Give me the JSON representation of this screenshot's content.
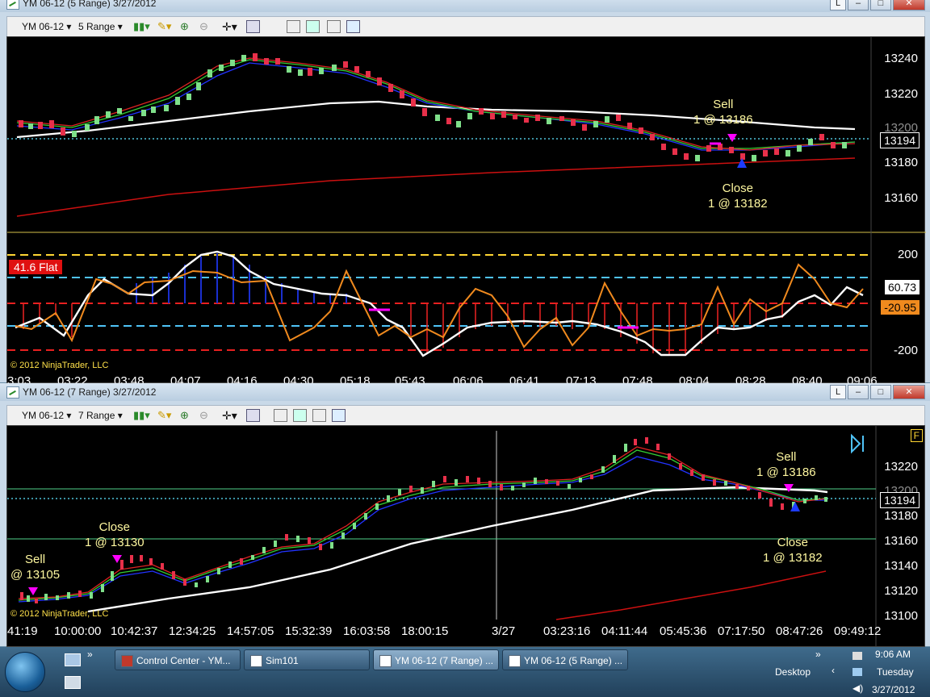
{
  "window_top": {
    "title": "YM 06-12 (5 Range)  3/27/2012",
    "toolbar": {
      "instrument": "YM 06-12",
      "period": "5 Range"
    },
    "price_panel": {
      "y_ticks": [
        "13240",
        "13220",
        "13200",
        "13180",
        "13160"
      ],
      "annotations": {
        "sell_title": "Sell",
        "sell_detail": "1 @ 13186",
        "close_title": "Close",
        "close_detail": "1 @ 13182"
      },
      "last_price": "13194",
      "ref_price": "13200"
    },
    "indicator_panel": {
      "badge": "41.6 Flat",
      "y_ticks": [
        "200",
        "-200"
      ],
      "value_white": "60.73",
      "value_orange": "-20.95",
      "copyright": "© 2012 NinjaTrader, LLC"
    },
    "x_ticks": [
      "3:03",
      "03:22",
      "03:48",
      "04:07",
      "04:16",
      "04:30",
      "05:18",
      "05:43",
      "06:06",
      "06:41",
      "07:13",
      "07:48",
      "08:04",
      "08:28",
      "08:40",
      "09:06"
    ]
  },
  "window_bottom": {
    "title": "YM 06-12 (7 Range)  3/27/2012",
    "toolbar": {
      "instrument": "YM 06-12",
      "period": "7 Range"
    },
    "lock_label": "L",
    "f_label": "F",
    "y_ticks": [
      "13220",
      "13200",
      "13180",
      "13160",
      "13140",
      "13120",
      "13100"
    ],
    "annotations": {
      "sell1_title": "Sell",
      "sell1_detail": "@ 13105",
      "close1_title": "Close",
      "close1_detail": "1 @ 13130",
      "sell2_title": "Sell",
      "sell2_detail": "1 @ 13186",
      "close2_title": "Close",
      "close2_detail": "1 @ 13182"
    },
    "last_price": "13194",
    "ref_price": "13199",
    "copyright": "© 2012 NinjaTrader, LLC",
    "x_ticks": [
      "41:19",
      "10:00:00",
      "10:42:37",
      "12:34:25",
      "14:57:05",
      "15:32:39",
      "16:03:58",
      "18:00:15",
      "3/27",
      "03:23:16",
      "04:11:44",
      "05:45:36",
      "07:17:50",
      "08:47:26",
      "09:49:12"
    ]
  },
  "taskbar": {
    "buttons": [
      "Control Center - YM...",
      "Sim101",
      "YM 06-12 (7 Range) ...",
      "YM 06-12 (5 Range) ..."
    ],
    "desktop_label": "Desktop",
    "time": "9:06 AM",
    "day": "Tuesday",
    "date": "3/27/2012"
  },
  "colors": {
    "sell_arrow": "#ff00ff",
    "buy_arrow": "#1e3cff",
    "ma_white": "#ffffff",
    "ma_red": "#cc1010",
    "candle_up": "#7fe08a",
    "candle_down": "#e8304a",
    "osc_orange": "#f08a1e",
    "last_price": "#4fc3d9"
  }
}
